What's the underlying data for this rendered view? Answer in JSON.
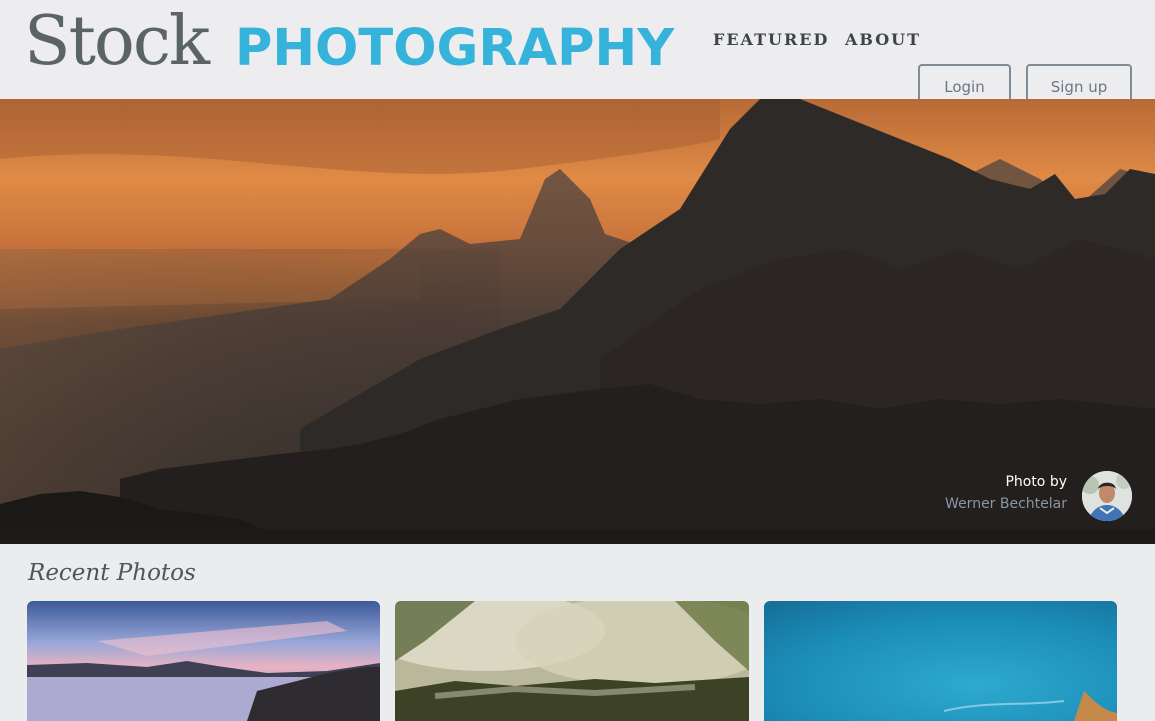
{
  "logo": {
    "stock": "Stock",
    "photography": "PHOTOGRAPHY"
  },
  "nav": {
    "featured": "FEATURED",
    "about": "ABOUT"
  },
  "auth": {
    "login": "Login",
    "signup": "Sign up"
  },
  "hero": {
    "credit_label": "Photo by",
    "photographer": "Werner Bechtelar"
  },
  "recent": {
    "title": "Recent Photos"
  },
  "colors": {
    "brand_blue": "#36b3db",
    "logo_gray": "#5a6466",
    "header_bg": "#ededef",
    "page_bg": "#ebecee"
  }
}
